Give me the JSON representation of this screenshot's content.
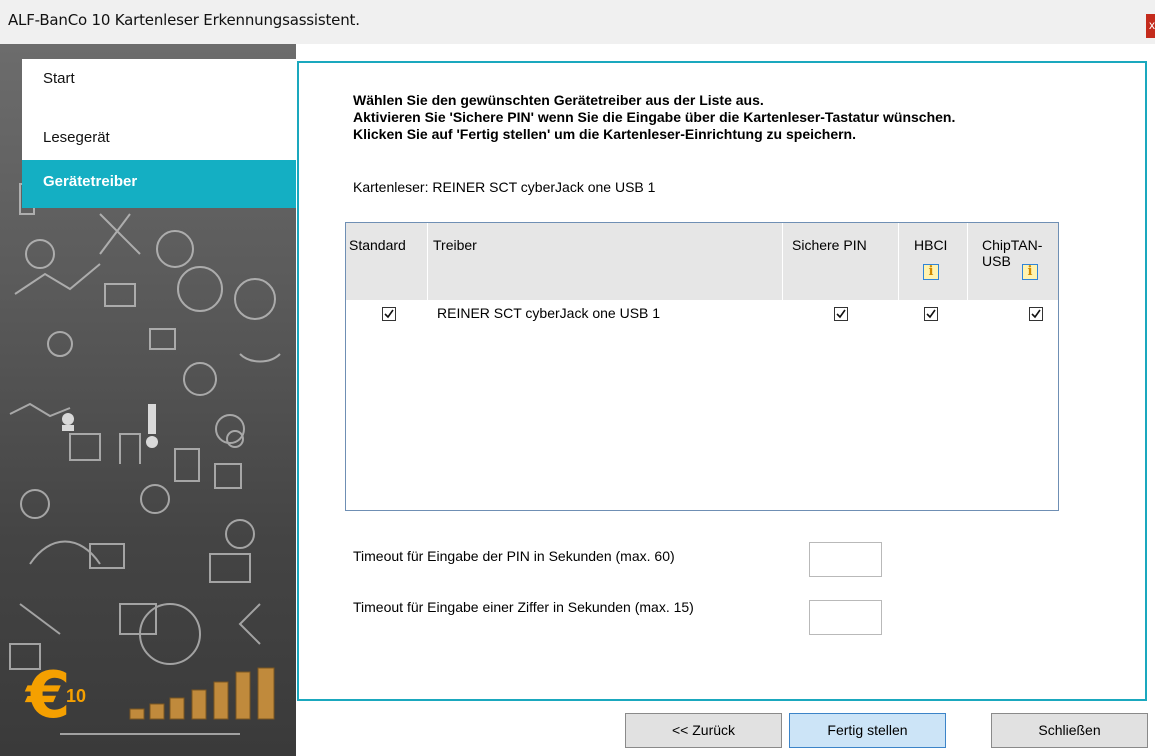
{
  "window": {
    "title": "ALF-BanCo 10 Kartenleser Erkennungsassistent.",
    "close_label": "x"
  },
  "sidebar": {
    "items": [
      {
        "label": "Start",
        "active": false
      },
      {
        "label": "Lesegerät",
        "active": false
      },
      {
        "label": "Gerätetreiber",
        "active": true
      }
    ],
    "logo": {
      "symbol": "€",
      "number": "10",
      "color": "#f5a000"
    }
  },
  "main": {
    "instructions": [
      "Wählen Sie den gewünschten Gerätetreiber aus der Liste aus.",
      "Aktivieren Sie 'Sichere PIN' wenn Sie die Eingabe über die Kartenleser-Tastatur wünschen.",
      "Klicken Sie auf 'Fertig stellen' um die Kartenleser-Einrichtung zu speichern."
    ],
    "reader_label": "Kartenleser: REINER SCT cyberJack one USB 1",
    "table": {
      "columns": [
        "Standard",
        "Treiber",
        "Sichere PIN",
        "HBCI",
        "ChipTAN-USB"
      ],
      "info_icon": "info-icon",
      "rows": [
        {
          "standard": true,
          "driver": "REINER SCT cyberJack one USB 1",
          "secure_pin": true,
          "hbci": true,
          "chiptan_usb": true
        }
      ]
    },
    "pin_timeout": {
      "label": "Timeout für Eingabe der PIN in Sekunden (max. 60)",
      "value": ""
    },
    "digit_timeout": {
      "label": "Timeout für Eingabe einer Ziffer in Sekunden (max. 15)",
      "value": ""
    }
  },
  "buttons": {
    "back": "<< Zurück",
    "finish": "Fertig stellen",
    "close": "Schließen"
  },
  "colors": {
    "accent": "#14afc3",
    "panel_border": "#1aa8be",
    "close_button": "#c42b1c",
    "primary_button": "#cce4f7"
  }
}
